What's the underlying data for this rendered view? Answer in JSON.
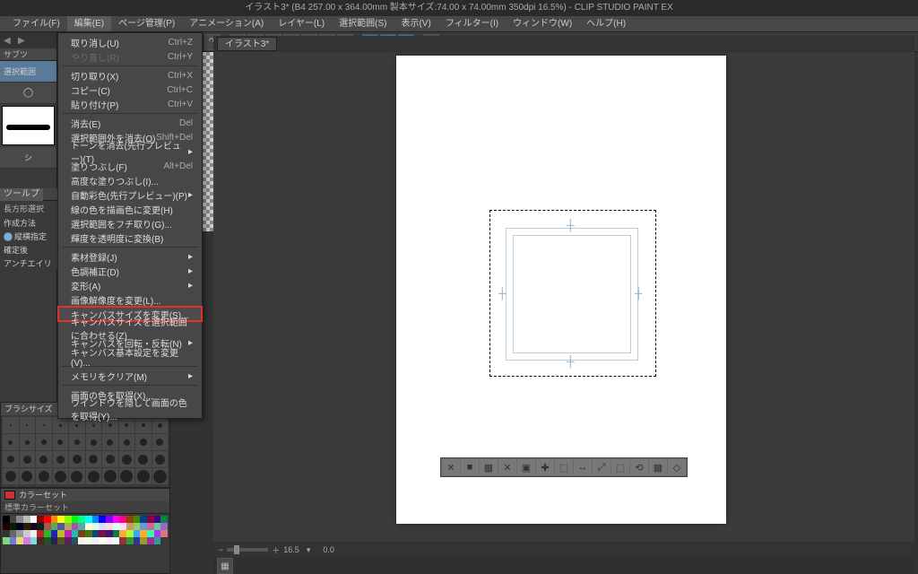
{
  "title": "イラスト3* (B4 257.00 x 364.00mm 製本サイズ:74.00 x 74.00mm 350dpi 16.5%)  -  CLIP STUDIO PAINT EX",
  "menubar": [
    "ファイル(F)",
    "編集(E)",
    "ページ管理(P)",
    "アニメーション(A)",
    "レイヤー(L)",
    "選択範囲(S)",
    "表示(V)",
    "フィルター(I)",
    "ウィンドウ(W)",
    "ヘルプ(H)"
  ],
  "menubar_open_index": 1,
  "document_tab": "イラスト3*",
  "edit_menu": [
    {
      "label": "取り消し(U)",
      "sc": "Ctrl+Z"
    },
    {
      "label": "やり直し(R)",
      "sc": "Ctrl+Y",
      "dis": true
    },
    {
      "sep": true
    },
    {
      "label": "切り取り(X)",
      "sc": "Ctrl+X"
    },
    {
      "label": "コピー(C)",
      "sc": "Ctrl+C"
    },
    {
      "label": "貼り付け(P)",
      "sc": "Ctrl+V"
    },
    {
      "sep": true
    },
    {
      "label": "消去(E)",
      "sc": "Del"
    },
    {
      "label": "選択範囲外を消去(O)",
      "sc": "Shift+Del"
    },
    {
      "label": "トーンを消去(先行プレビュー)(T)",
      "sub": true
    },
    {
      "label": "塗りつぶし(F)",
      "sc": "Alt+Del"
    },
    {
      "label": "高度な塗りつぶし(I)..."
    },
    {
      "label": "自動彩色(先行プレビュー)(P)",
      "sub": true
    },
    {
      "label": "線の色を描画色に変更(H)"
    },
    {
      "label": "選択範囲をフチ取り(G)..."
    },
    {
      "label": "輝度を透明度に変換(B)"
    },
    {
      "sep": true
    },
    {
      "label": "素材登録(J)",
      "sub": true
    },
    {
      "label": "色調補正(D)",
      "sub": true
    },
    {
      "label": "変形(A)",
      "sub": true
    },
    {
      "label": "画像解像度を変更(L)..."
    },
    {
      "label": "キャンバスサイズを変更(S)...",
      "hl": true
    },
    {
      "label": "キャンバスサイズを選択範囲に合わせる(Z)"
    },
    {
      "label": "キャンバスを回転・反転(N)",
      "sub": true
    },
    {
      "label": "キャンバス基本設定を変更(V)..."
    },
    {
      "sep": true
    },
    {
      "label": "メモリをクリア(M)",
      "sub": true
    },
    {
      "sep": true
    },
    {
      "label": "画面の色を取得(X)..."
    },
    {
      "label": "ウインドウを隠して画面の色を取得(Y)..."
    }
  ],
  "toolbar_icons": [
    "circle",
    "chev-l",
    "chev-r",
    "sep",
    "doc",
    "folder",
    "save",
    "sep",
    "refresh",
    "gear",
    "target",
    "sep",
    "undo",
    "redo",
    "sep",
    "cut",
    "crop",
    "move",
    "zoom",
    "hand",
    "grid",
    "lasso",
    "sep",
    "pen-blue",
    "line-blue",
    "rect-blue",
    "sep",
    "help"
  ],
  "left": {
    "sub_tab": "サブツ",
    "selection_label": "選択範囲",
    "tool_prop_tab": "ツールプ",
    "tool_prop_title": "長方形選択",
    "rows": [
      {
        "k": "作成方法",
        "v": ""
      },
      {
        "k": "",
        "v": "縦横指定",
        "dot": true
      },
      {
        "k": "",
        "v": "確定後"
      },
      {
        "k": "アンチエイリ",
        "v": ""
      }
    ]
  },
  "brush_header": "ブラシサイズ",
  "brush_sizes": [
    0.7,
    1,
    1.5,
    2,
    3,
    4,
    5,
    6,
    3,
    4,
    "",
    "",
    "",
    "",
    "",
    "",
    "",
    "",
    "",
    "",
    "",
    "",
    "",
    "",
    "",
    "",
    "",
    "",
    "",
    "",
    "",
    "",
    "",
    "",
    "",
    "",
    "",
    "",
    "",
    ""
  ],
  "colorset": {
    "tab": "カラーセット",
    "bar": "標準カラーセット"
  },
  "swatch_colors": [
    "#000",
    "#444",
    "#888",
    "#bbb",
    "#fff",
    "#800",
    "#f00",
    "#f80",
    "#ff0",
    "#8f0",
    "#0f0",
    "#0f8",
    "#0ff",
    "#08f",
    "#00f",
    "#80f",
    "#f0f",
    "#f08",
    "#840",
    "#480",
    "#048",
    "#804",
    "#408",
    "#084",
    "#200",
    "#020",
    "#002",
    "#220",
    "#202",
    "#022",
    "#a55",
    "#5a5",
    "#55a",
    "#aa5",
    "#a5a",
    "#5aa",
    "#ffd",
    "#dfd",
    "#ddf",
    "#fdd",
    "#dff",
    "#fdf",
    "#c96",
    "#9c6",
    "#69c",
    "#c69",
    "#6c9",
    "#96c",
    "#333",
    "#666",
    "#999",
    "#ccc",
    "#eee",
    "#b22",
    "#2b2",
    "#22b",
    "#bb2",
    "#b2b",
    "#2bb",
    "#741",
    "#471",
    "#147",
    "#714",
    "#417",
    "#174",
    "#fa3",
    "#af3",
    "#3af",
    "#fa3",
    "#3fa",
    "#a3f",
    "#d77",
    "#7d7",
    "#77d",
    "#dd7",
    "#d7d",
    "#7dd",
    "#522",
    "#252",
    "#225",
    "#552",
    "#525",
    "#255",
    "#fee",
    "#efe",
    "#eef",
    "#ffe",
    "#fef",
    "#eff",
    "#933",
    "#393",
    "#339",
    "#993",
    "#939",
    "#399"
  ],
  "float_tools": [
    "✕",
    "■",
    "▦",
    "✕",
    "▣",
    "✚",
    "⬚",
    "↔",
    "⤢",
    "⬚",
    "⟲",
    "▦",
    "◇"
  ],
  "status": {
    "zoom": "16.5",
    "angle": "0.0"
  }
}
